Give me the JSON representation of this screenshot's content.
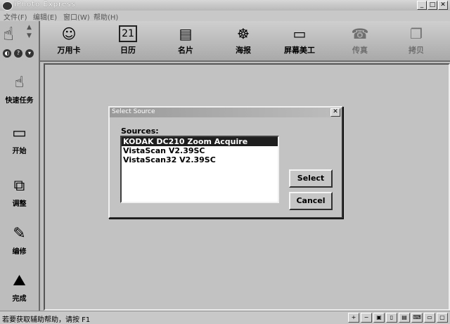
{
  "window": {
    "title": "iPhoto Express",
    "min_glyph": "_",
    "max_glyph": "□",
    "close_glyph": "✕"
  },
  "menu": [
    {
      "label": "文件(F)"
    },
    {
      "label": "编辑(E)"
    },
    {
      "label": "窗口(W)"
    },
    {
      "label": "帮助(H)"
    }
  ],
  "toolbar": {
    "items": [
      {
        "label": "万用卡",
        "icon": "smiley-card-icon",
        "glyph": "☺"
      },
      {
        "label": "日历",
        "icon": "calendar-icon",
        "glyph": "21"
      },
      {
        "label": "名片",
        "icon": "business-card-icon",
        "glyph": "▤"
      },
      {
        "label": "海报",
        "icon": "poster-icon",
        "glyph": "☸"
      },
      {
        "label": "屏幕美工",
        "icon": "monitor-icon",
        "glyph": "▭"
      },
      {
        "label": "传真",
        "icon": "fax-icon",
        "glyph": "☎"
      },
      {
        "label": "拷贝",
        "icon": "copy-icon",
        "glyph": "❐"
      }
    ]
  },
  "sidebar": {
    "items": [
      {
        "label": "快速任务",
        "icon": "hand-pointer-icon",
        "glyph": "☝"
      },
      {
        "label": "开始",
        "icon": "start-icon",
        "glyph": "▭"
      },
      {
        "label": "调整",
        "icon": "adjust-icon",
        "glyph": "⧉"
      },
      {
        "label": "编修",
        "icon": "edit-brush-icon",
        "glyph": "✎"
      },
      {
        "label": "完成",
        "icon": "finish-icon",
        "glyph": "⛰"
      }
    ]
  },
  "dialog": {
    "title": "Select Source",
    "sources_label": "Sources:",
    "sources": [
      "KODAK DC210 Zoom Acquire",
      "VistaScan V2.39SC",
      "VistaScan32 V2.39SC"
    ],
    "selected_index": 0,
    "select_button": "Select",
    "cancel_button": "Cancel",
    "close_glyph": "✕"
  },
  "statusbar": {
    "text": "若要获取辅助帮助，请按 F1"
  }
}
